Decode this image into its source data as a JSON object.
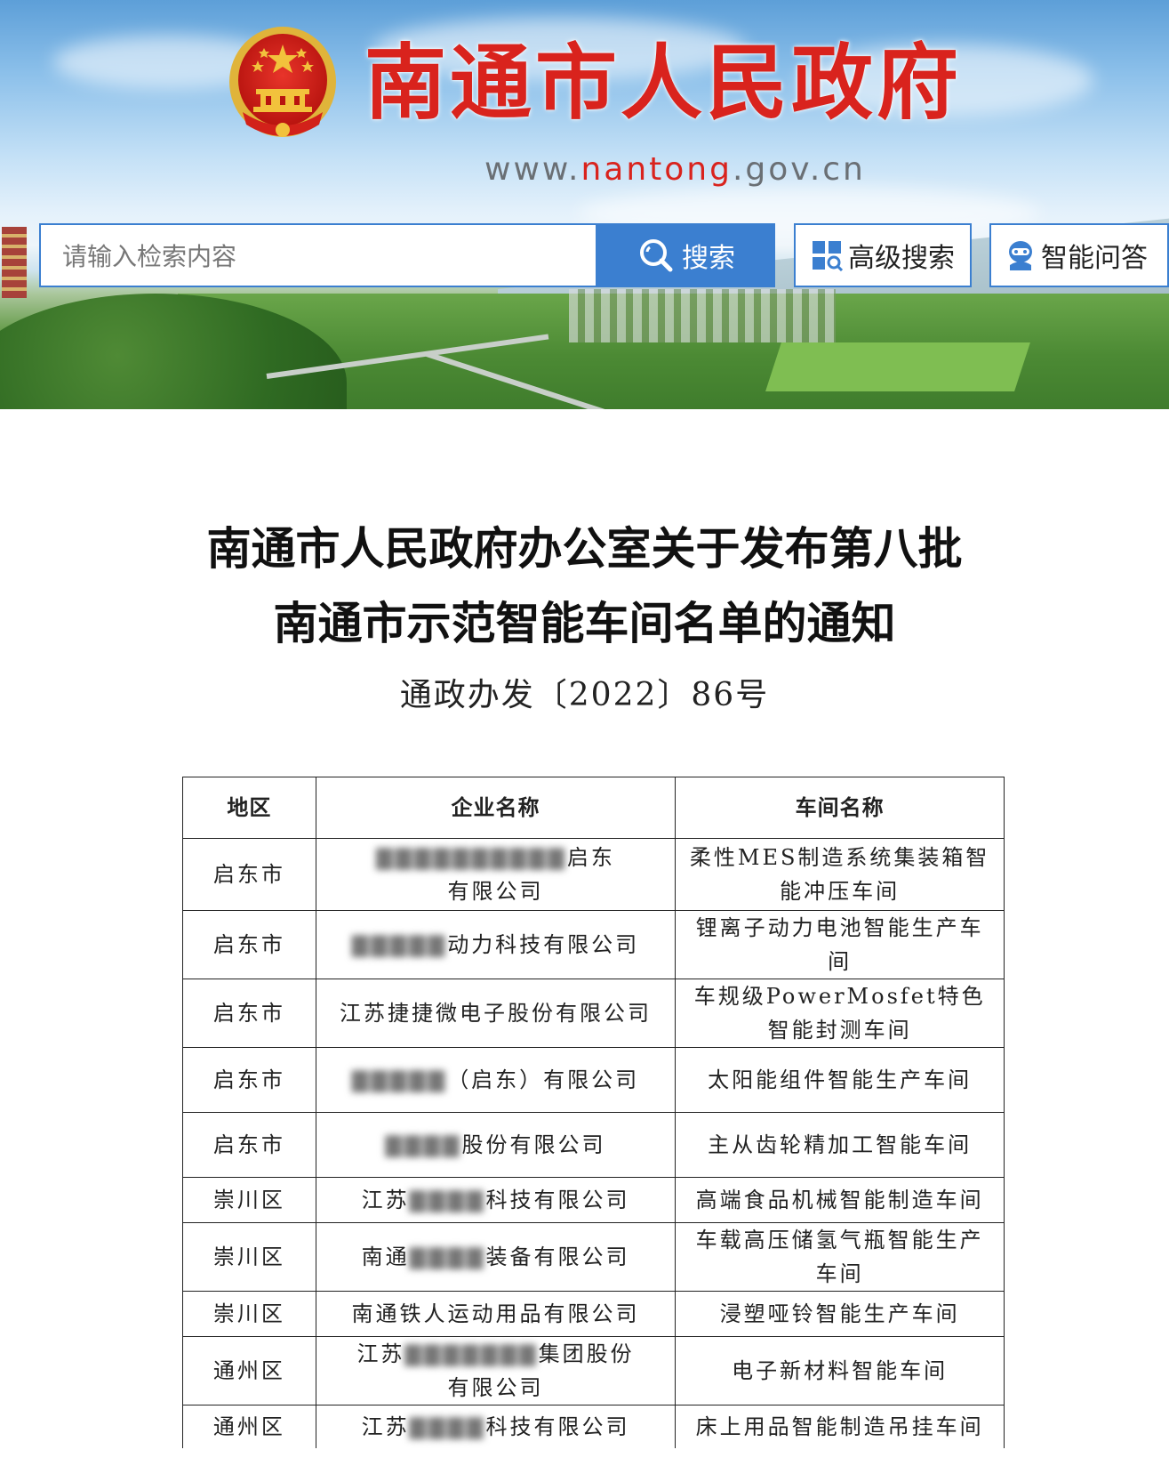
{
  "site": {
    "title": "南通市人民政府",
    "url_prefix": "www.",
    "url_highlight": "nantong",
    "url_suffix": ".gov.cn",
    "brand_color": "#d9231d"
  },
  "search": {
    "placeholder": "请输入检索内容",
    "button_label": "搜索",
    "advanced_label": "高级搜索",
    "qa_label": "智能问答",
    "accent_color": "#3b7fd0"
  },
  "article": {
    "title_line1": "南通市人民政府办公室关于发布第八批",
    "title_line2": "南通市示范智能车间名单的通知",
    "doc_number": "通政办发〔2022〕86号"
  },
  "table": {
    "headers": [
      "地区",
      "企业名称",
      "车间名称"
    ],
    "rows": [
      {
        "region": "启东市",
        "company_hidden": "▇▇▇▇▇▇▇▇▇▇",
        "company_visible": "启东",
        "company_line2": "有限公司",
        "workshop": "柔性MES制造系统集装箱智能冲压车间"
      },
      {
        "region": "启东市",
        "company_hidden": "▇▇▇▇▇",
        "company_visible": "动力科技有限公司",
        "company_line2": "",
        "workshop": "锂离子动力电池智能生产车间"
      },
      {
        "region": "启东市",
        "company_hidden": "",
        "company_visible": "江苏捷捷微电子股份有限公司",
        "company_line2": "",
        "workshop": "车规级PowerMosfet特色智能封测车间"
      },
      {
        "region": "启东市",
        "company_hidden": "▇▇▇▇▇",
        "company_visible": "（启东）有限公司",
        "company_line2": "",
        "workshop": "太阳能组件智能生产车间"
      },
      {
        "region": "启东市",
        "company_hidden": "▇▇▇▇",
        "company_visible": "股份有限公司",
        "company_line2": "",
        "workshop": "主从齿轮精加工智能车间"
      },
      {
        "region": "崇川区",
        "company_prefix": "江苏",
        "company_hidden": "▇▇▇▇",
        "company_visible": "科技有限公司",
        "company_line2": "",
        "workshop": "高端食品机械智能制造车间"
      },
      {
        "region": "崇川区",
        "company_prefix": "南通",
        "company_hidden": "▇▇▇▇",
        "company_visible": "装备有限公司",
        "company_line2": "",
        "workshop": "车载高压储氢气瓶智能生产车间"
      },
      {
        "region": "崇川区",
        "company_hidden": "",
        "company_visible": "南通铁人运动用品有限公司",
        "company_line2": "",
        "workshop": "浸塑哑铃智能生产车间"
      },
      {
        "region": "通州区",
        "company_prefix": "江苏",
        "company_hidden": "▇▇▇▇▇▇▇",
        "company_visible": "集团股份",
        "company_line2": "有限公司",
        "workshop": "电子新材料智能车间"
      },
      {
        "region": "通州区",
        "company_prefix": "江苏",
        "company_hidden": "▇▇▇▇",
        "company_visible": "科技有限公司",
        "company_line2": "",
        "workshop": "床上用品智能制造吊挂车间"
      }
    ]
  }
}
